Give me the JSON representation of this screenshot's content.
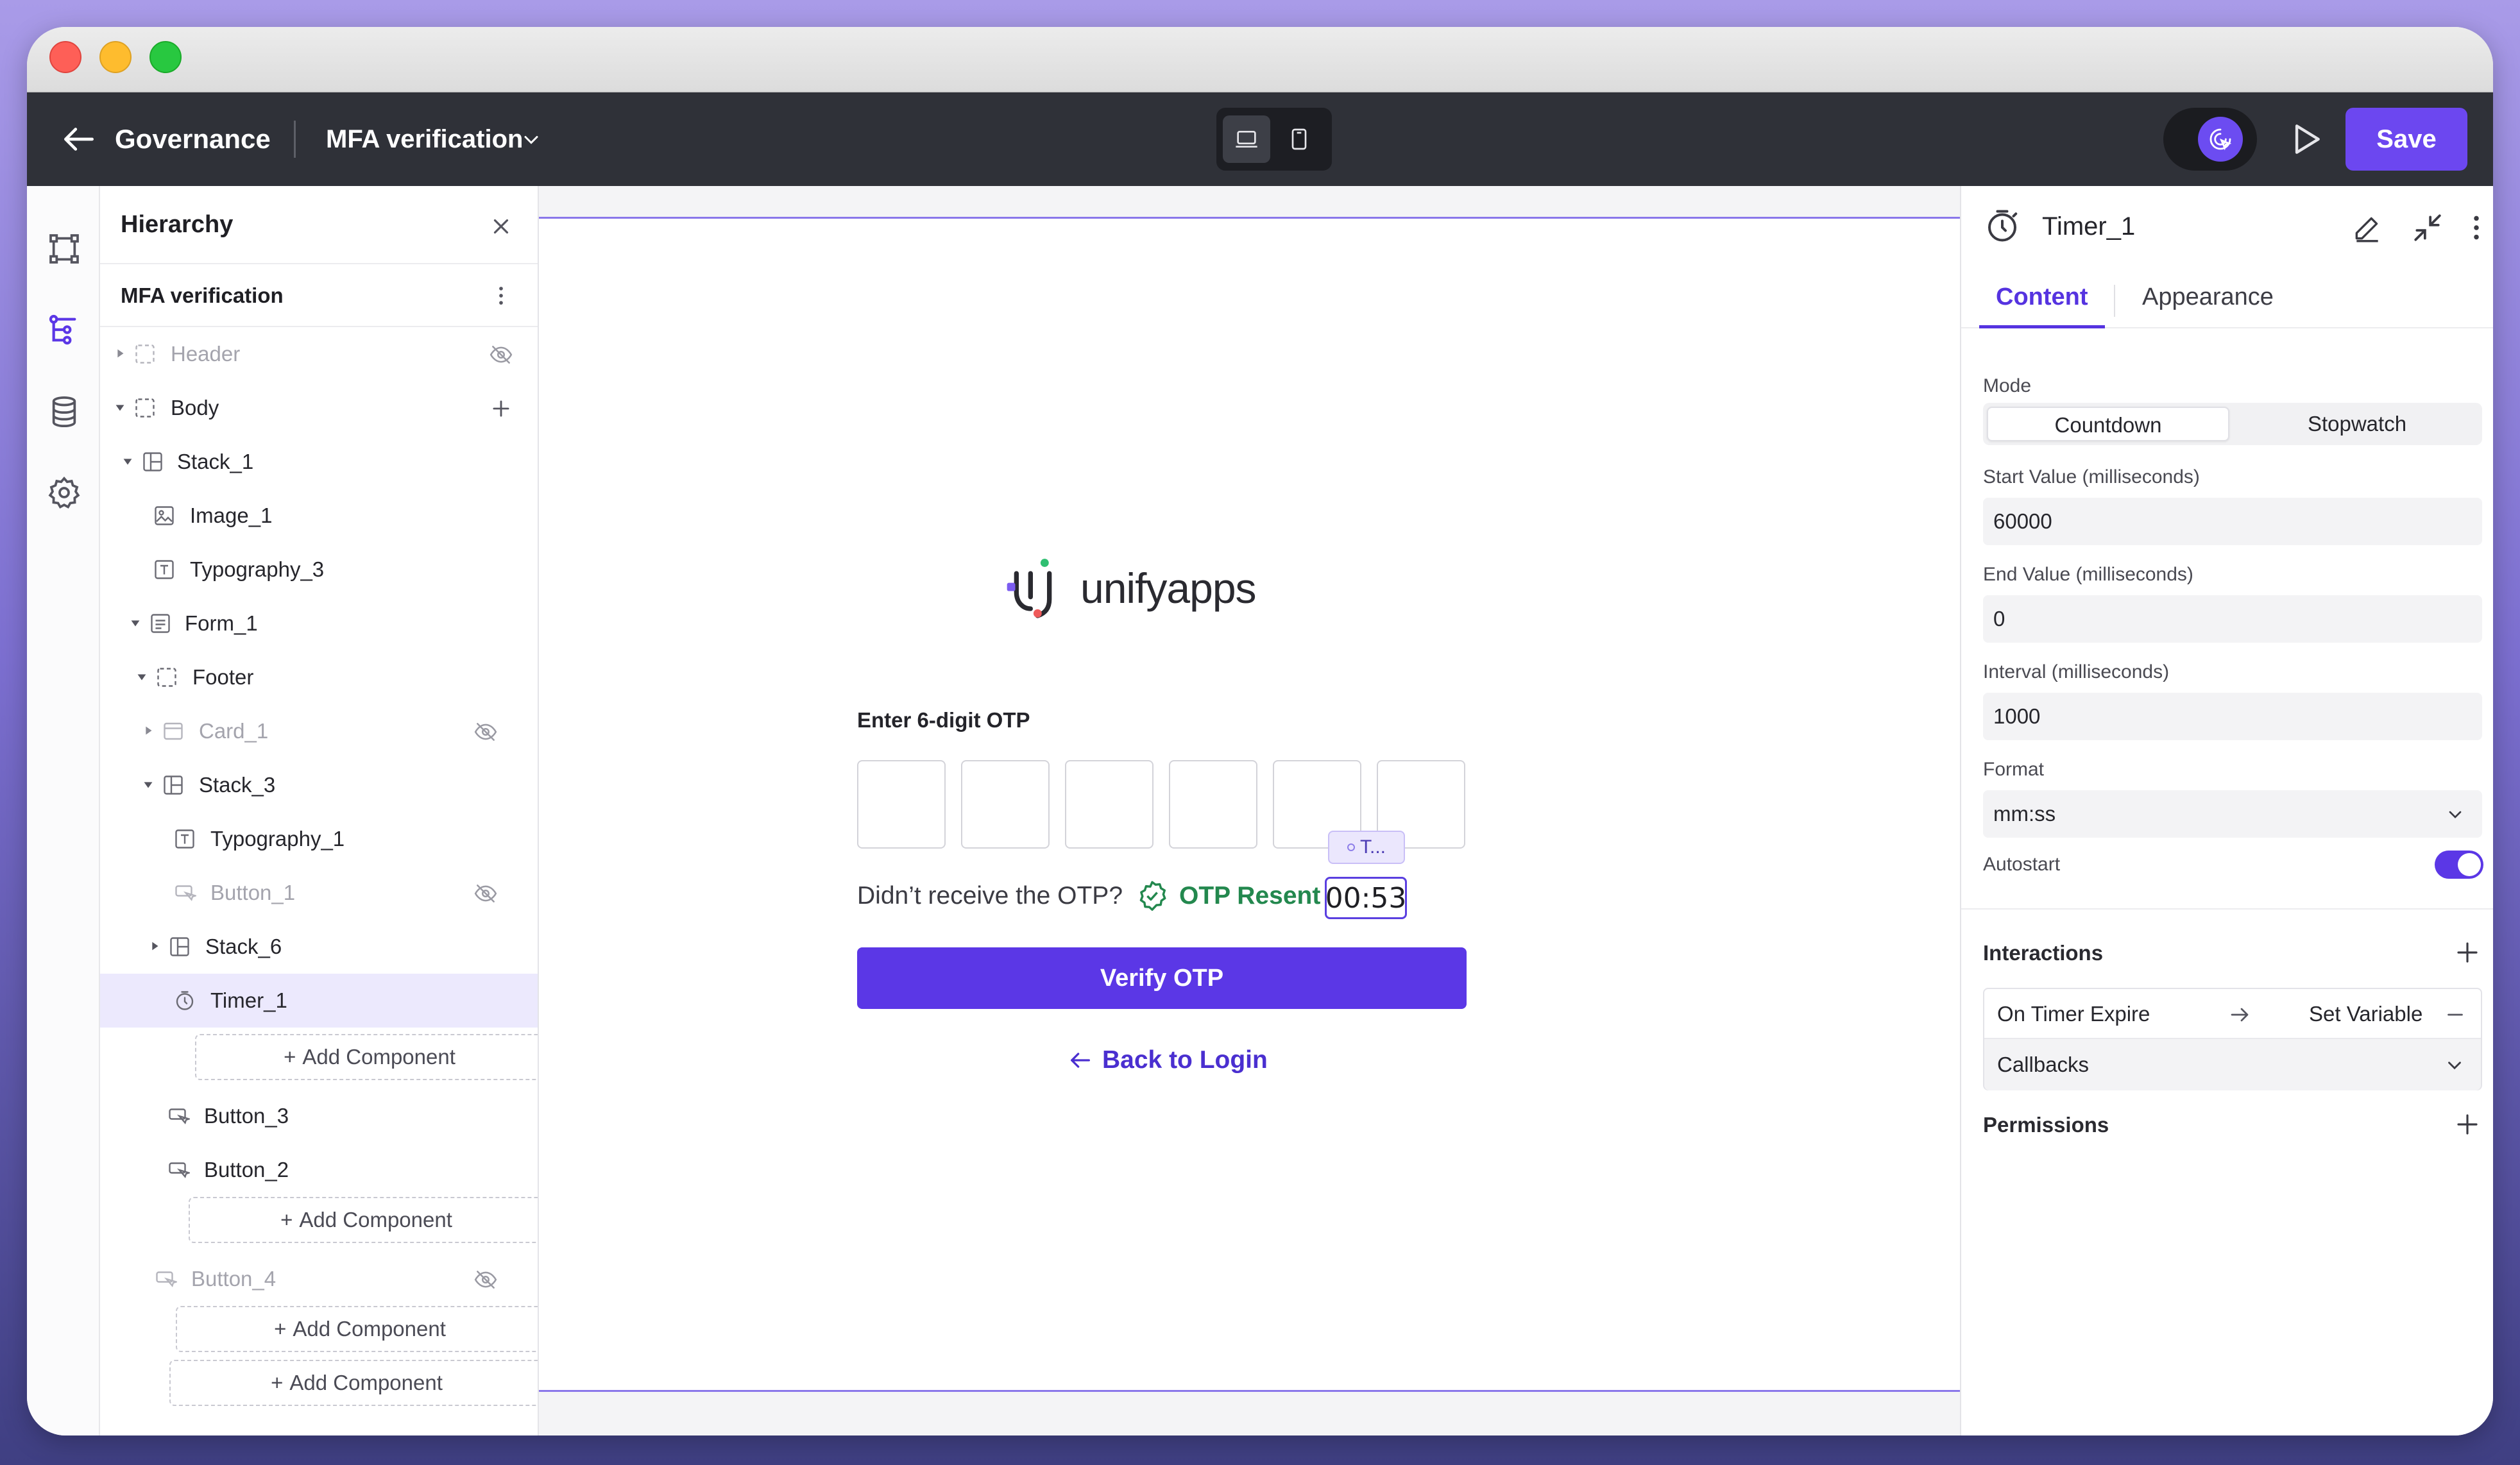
{
  "app": {
    "back_label": "Governance",
    "flow_name": "MFA verification",
    "save_label": "Save",
    "accent_color": "#6c47f0"
  },
  "rail": {
    "icons": [
      "canvas-icon",
      "hierarchy-icon",
      "database-icon",
      "settings-icon"
    ]
  },
  "hierarchy": {
    "title": "Hierarchy",
    "flow_label": "MFA verification",
    "items": [
      {
        "label": "Header",
        "icon": "container-icon",
        "hidden": true
      },
      {
        "label": "Body",
        "icon": "container-icon"
      },
      {
        "label": "Stack_1",
        "icon": "stack-icon"
      },
      {
        "label": "Image_1",
        "icon": "image-icon"
      },
      {
        "label": "Typography_3",
        "icon": "typography-icon"
      },
      {
        "label": "Form_1",
        "icon": "form-icon"
      },
      {
        "label": "Footer",
        "icon": "container-icon"
      },
      {
        "label": "Card_1",
        "icon": "card-icon",
        "hidden": true
      },
      {
        "label": "Stack_3",
        "icon": "stack-icon"
      },
      {
        "label": "Typography_1",
        "icon": "typography-icon"
      },
      {
        "label": "Button_1",
        "icon": "button-icon",
        "hidden": true
      },
      {
        "label": "Stack_6",
        "icon": "stack-icon"
      },
      {
        "label": "Timer_1",
        "icon": "timer-icon",
        "selected": true
      },
      {
        "label": "Button_3",
        "icon": "button-icon"
      },
      {
        "label": "Button_2",
        "icon": "button-icon"
      },
      {
        "label": "Button_4",
        "icon": "button-icon",
        "hidden": true
      }
    ],
    "add_component_label": "Add Component"
  },
  "canvas": {
    "logo_text": "unifyapps",
    "otp_label": "Enter 6-digit OTP",
    "otp_boxes": 6,
    "tooltip_chip": "T...",
    "resend_question": "Didn’t receive the OTP?",
    "resend_status": "OTP Resent",
    "timer_value": "00:53",
    "verify_label": "Verify OTP",
    "back_label": "Back to Login"
  },
  "properties": {
    "title": "Timer_1",
    "tabs": [
      "Content",
      "Appearance"
    ],
    "mode_label": "Mode",
    "mode_options": [
      "Countdown",
      "Stopwatch"
    ],
    "mode_selected": "Countdown",
    "start_label": "Start Value (milliseconds)",
    "start_value": "60000",
    "end_label": "End Value (milliseconds)",
    "end_value": "0",
    "interval_label": "Interval (milliseconds)",
    "interval_value": "1000",
    "format_label": "Format",
    "format_value": "mm:ss",
    "autostart_label": "Autostart",
    "autostart": true,
    "interactions_title": "Interactions",
    "interaction_trigger": "On Timer Expire",
    "interaction_action": "Set Variable",
    "callbacks_label": "Callbacks",
    "permissions_title": "Permissions"
  }
}
